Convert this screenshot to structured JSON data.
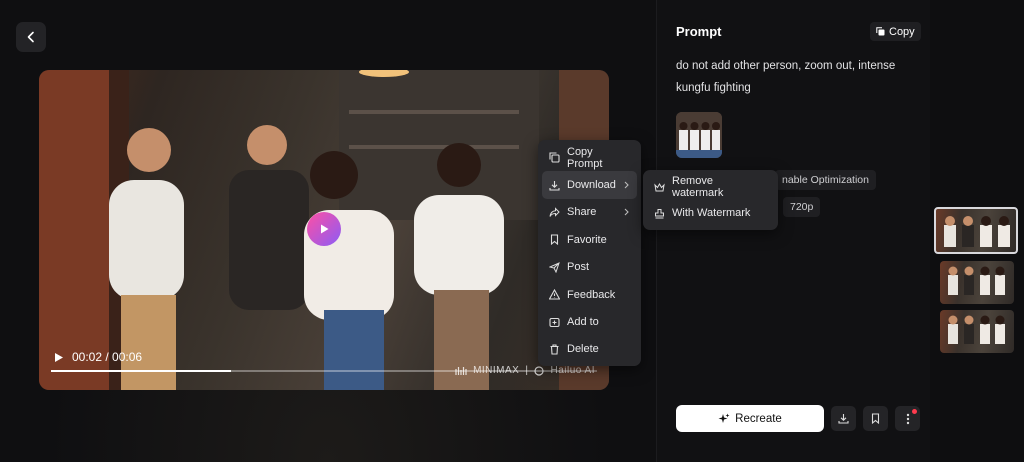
{
  "video": {
    "time": "00:02 / 00:06",
    "progress": 0.33,
    "watermark_brand": "MINIMAX",
    "watermark_separator": "|",
    "watermark_product": "Hailuo AI"
  },
  "context_menu": {
    "items": [
      {
        "label": "Copy Prompt",
        "icon": "copy-icon"
      },
      {
        "label": "Download",
        "icon": "download-icon",
        "has_submenu": true
      },
      {
        "label": "Share",
        "icon": "share-icon",
        "has_submenu": true
      },
      {
        "label": "Favorite",
        "icon": "bookmark-icon"
      },
      {
        "label": "Post",
        "icon": "send-icon"
      },
      {
        "label": "Feedback",
        "icon": "warning-icon"
      },
      {
        "label": "Add to",
        "icon": "add-to-icon"
      },
      {
        "label": "Delete",
        "icon": "trash-icon"
      }
    ]
  },
  "download_submenu": {
    "items": [
      {
        "label": "Remove watermark",
        "icon": "crown-icon"
      },
      {
        "label": "With Watermark",
        "icon": "stamp-icon"
      }
    ]
  },
  "sidebar": {
    "title": "Prompt",
    "copy_label": "Copy",
    "prompt_text": "do not add other person, zoom out, intense kungfu fighting",
    "optimization_chip": "nable Optimization",
    "resolution_chip": "720p",
    "recreate_label": "Recreate"
  },
  "colors": {
    "accent_gradient_start": "#ff4fa3",
    "accent_gradient_end": "#8b5cf6",
    "notification_dot": "#ff3b4e"
  }
}
